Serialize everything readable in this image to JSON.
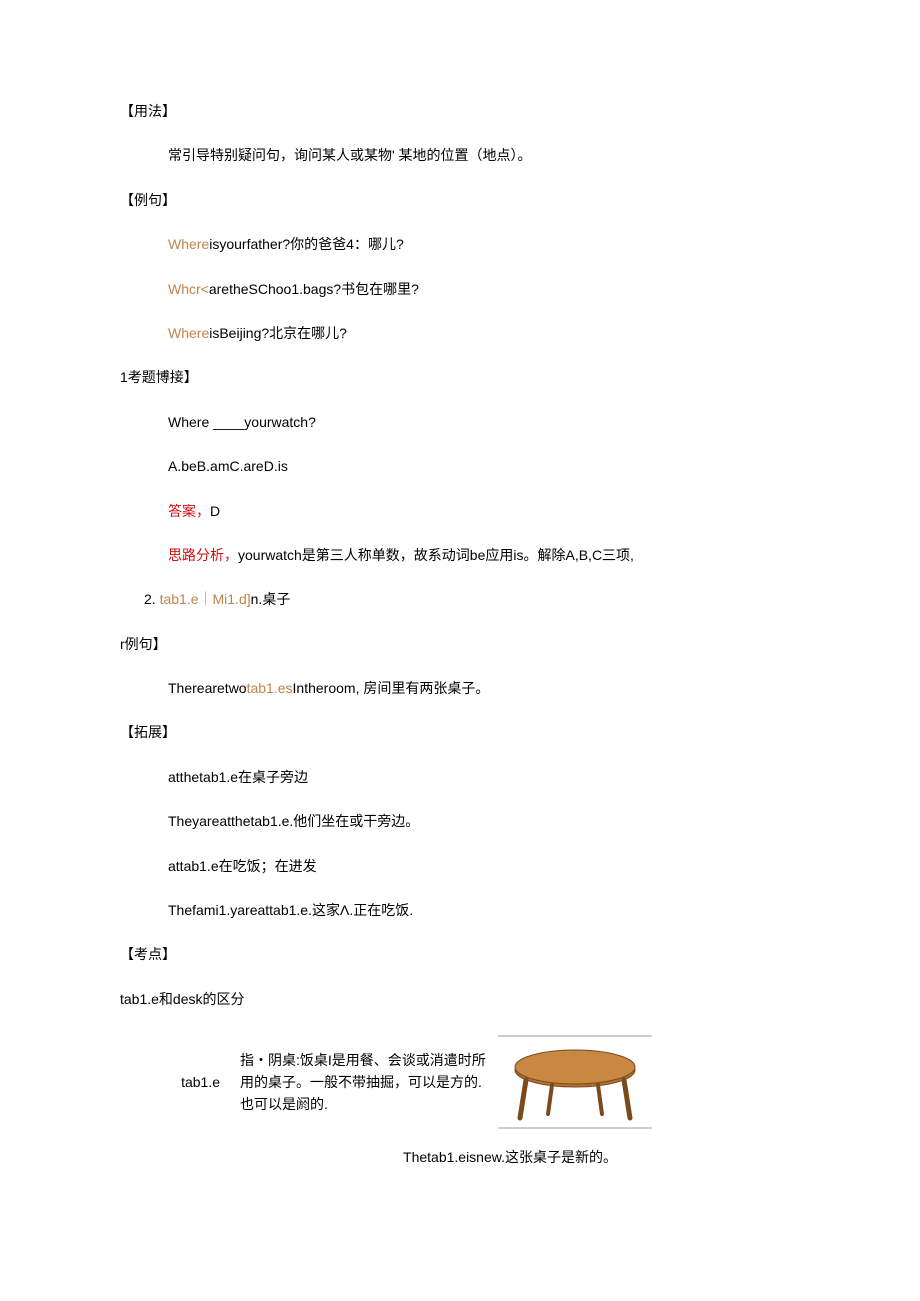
{
  "usage_heading": "【用法】",
  "usage_text": "常引导特别疑问句，询问某人或某物' 某地的位置（地点）。",
  "example_heading": "【例句】",
  "ex1_orange": "Where",
  "ex1_rest": "isyourfather?你的爸爸4：哪儿?",
  "ex2_orange": "Whcr<",
  "ex2_rest": "aretheSChoo1.bags?书包在哪里?",
  "ex3_orange": "Where",
  "ex3_rest": "isBeijing?北京在哪儿?",
  "exam_heading": "1考题博接】",
  "exam_q_pre": "Where  ",
  "exam_q_blank": "____",
  "exam_q_post": "yourwatch?",
  "exam_options": "A.beB.amC.areD.is",
  "ans_label": "答案，",
  "ans_value": "D",
  "analysis_label": "思路分析，",
  "analysis_text": "yourwatch是第三人称单数，故系动词be应用is。解除A,B,C三项,",
  "item2_num": "2.   ",
  "item2_orange": "tab1.e｜Mi1.d]",
  "item2_rest": "n.桌子",
  "rex_heading": "r例句】",
  "rex_pre": "Therearetwo",
  "rex_orange": "tab1.es",
  "rex_post": "Intheroom, 房间里有两张桌子。",
  "ext_heading": "【拓展】",
  "ext1": "atthetab1.e在桌子旁边",
  "ext2": "Theyareatthetab1.e.他们坐在或干旁边。",
  "ext3": "attab1.e在吃饭；在进发",
  "ext4": "Thefami1.yareattab1.e.这家Λ.正在吃饭.",
  "kaodian_heading": "【考点】",
  "kaodian_text": "tab1.e和desk的区分",
  "row_label": "tab1.e",
  "row_def": "指・阴桌:饭桌I是用餐、会谈或消遣时所用的桌子。一般不带抽掘，可以是方的. 也可以是阏的.",
  "caption": "Thetab1.eisnew.这张桌子是新的。"
}
